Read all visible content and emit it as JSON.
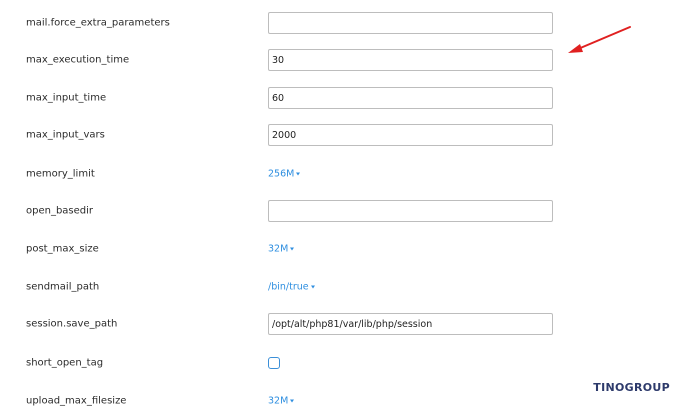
{
  "settings": [
    {
      "label": "mail.force_extra_parameters",
      "type": "text",
      "value": ""
    },
    {
      "label": "max_execution_time",
      "type": "text",
      "value": "30"
    },
    {
      "label": "max_input_time",
      "type": "text",
      "value": "60"
    },
    {
      "label": "max_input_vars",
      "type": "text",
      "value": "2000"
    },
    {
      "label": "memory_limit",
      "type": "dropdown",
      "value": "256M"
    },
    {
      "label": "open_basedir",
      "type": "text",
      "value": ""
    },
    {
      "label": "post_max_size",
      "type": "dropdown",
      "value": "32M"
    },
    {
      "label": "sendmail_path",
      "type": "dropdown",
      "value": "/bin/true"
    },
    {
      "label": "session.save_path",
      "type": "text",
      "value": "/opt/alt/php81/var/lib/php/session"
    },
    {
      "label": "short_open_tag",
      "type": "checkbox",
      "checked": false
    },
    {
      "label": "upload_max_filesize",
      "type": "dropdown",
      "value": "32M"
    }
  ],
  "annotation": {
    "arrow_color": "#e02020",
    "icon": "arrow-left-down-icon"
  },
  "watermark": {
    "text": "TINOGROUP"
  },
  "colors": {
    "link": "#2f8fe0",
    "checkbox_border": "#3b8fd8"
  }
}
